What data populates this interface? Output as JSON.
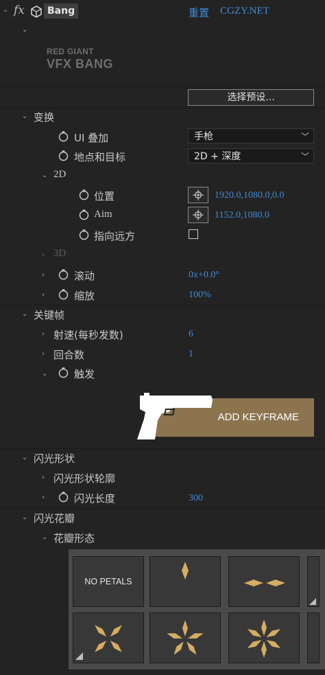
{
  "header": {
    "fx_symbol": "fx",
    "effect_name": "Bang",
    "reset_label": "重置",
    "site_label": "CGZY.NET"
  },
  "logo": {
    "line1": "RED GIANT",
    "line2": "VFX BANG"
  },
  "preset_button": "选择预设...",
  "groups": {
    "transform": "变换",
    "ui_overlay": "UI 叠加",
    "ui_overlay_value": "手枪",
    "location_target": "地点和目标",
    "location_target_value": "2D + 深度",
    "group_2d": "2D",
    "position": "位置",
    "position_value": "1920.0,1080.0,0.0",
    "aim": "Aim",
    "aim_value": "1152.0,1080.0",
    "point_away": "指向远方",
    "group_3d": "3D",
    "roll": "滚动",
    "roll_value": "0x+0.0°",
    "scale": "缩放",
    "scale_value": "100%",
    "keyframe": "关键帧",
    "fire_rate": "射速(每秒发数)",
    "fire_rate_value": "6",
    "rounds": "回合数",
    "rounds_value": "1",
    "trigger": "触发",
    "add_keyframe": "ADD KEYFRAME",
    "flash_shape": "闪光形状",
    "flash_shape_outline": "闪光形状轮廓",
    "flash_length": "闪光长度",
    "flash_length_value": "300",
    "flash_petals": "闪光花瓣",
    "petal_form": "花瓣形态",
    "no_petals": "NO PETALS"
  },
  "colors": {
    "background": "#232323",
    "link": "#3f8ad8",
    "keyframe_button": "#8c744f"
  },
  "icons": {
    "stopwatch": "stopwatch-icon",
    "crosshair": "crosshair-icon",
    "twirl_down": "chevron-down-icon",
    "twirl_right": "chevron-right-icon",
    "pistol": "pistol-icon"
  }
}
